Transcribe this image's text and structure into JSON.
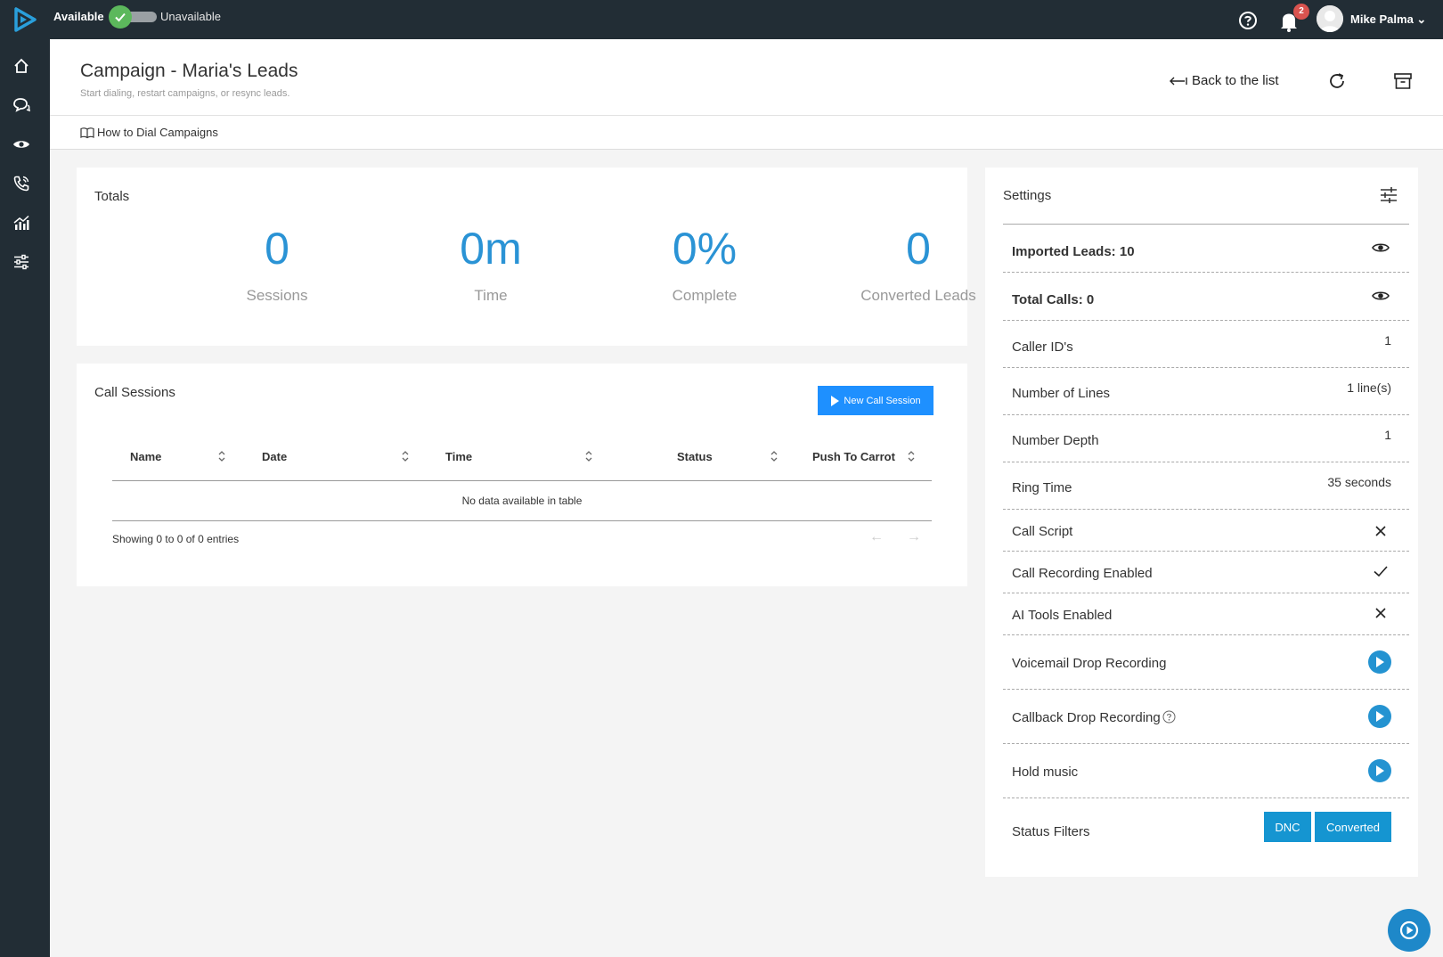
{
  "topbar": {
    "available_label": "Available",
    "unavailable_label": "Unavailable",
    "notifications_count": "2",
    "user_name": "Mike Palma ⌄"
  },
  "header": {
    "title": "Campaign - Maria's Leads",
    "subtitle": "Start dialing, restart campaigns, or resync leads.",
    "back_label": "Back to the list",
    "howto_label": "How to Dial Campaigns"
  },
  "totals": {
    "title": "Totals",
    "stats": [
      {
        "value": "0",
        "label": "Sessions"
      },
      {
        "value": "0m",
        "label": "Time"
      },
      {
        "value": "0%",
        "label": "Complete"
      },
      {
        "value": "0",
        "label": "Converted Leads"
      }
    ]
  },
  "call_sessions": {
    "title": "Call Sessions",
    "new_button": "New Call Session",
    "columns": [
      "Name",
      "Date",
      "Time",
      "Status",
      "Push To Carrot"
    ],
    "empty_message": "No data available in table",
    "showing": "Showing 0 to 0 of 0 entries",
    "prev": "←",
    "next": "→"
  },
  "settings": {
    "title": "Settings",
    "rows": [
      {
        "label": "Imported Leads: 10",
        "kind": "eye"
      },
      {
        "label": "Total Calls: 0",
        "kind": "eye"
      },
      {
        "label": "Caller ID's",
        "value": "1"
      },
      {
        "label": "Number of Lines",
        "value": "1 line(s)"
      },
      {
        "label": "Number Depth",
        "value": "1"
      },
      {
        "label": "Ring Time",
        "value": "35 seconds"
      },
      {
        "label": "Call Script",
        "kind": "cross"
      },
      {
        "label": "Call Recording Enabled",
        "kind": "check"
      },
      {
        "label": "AI Tools Enabled",
        "kind": "cross"
      },
      {
        "label": "Voicemail Drop Recording",
        "kind": "play"
      },
      {
        "label": "Callback Drop Recording",
        "kind": "play"
      },
      {
        "label": "Hold music",
        "kind": "play"
      },
      {
        "label": "Status Filters"
      }
    ],
    "status_filters": [
      "DNC",
      "Converted"
    ]
  },
  "colors": {
    "topbar": "#222d35",
    "accent_blue": "#2a93d5",
    "button_blue": "#1e90ff",
    "available_green": "#5cb85c",
    "badge_red": "#d9534f"
  }
}
